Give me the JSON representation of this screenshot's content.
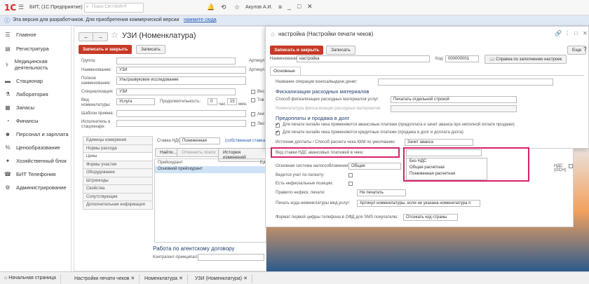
{
  "topbar": {
    "app": "БИТ, (1С:Предприятие)",
    "search_placeholder": "Поиск Ctrl+Shift+F",
    "user": "Акулов А.И."
  },
  "infobar": {
    "text": "Эта версия для разработчиков. Для приобретения коммерческой версии",
    "link": "нажмите сюда"
  },
  "sidebar": {
    "items": [
      {
        "label": "Главное",
        "icon": "menu-icon"
      },
      {
        "label": "Регистратура",
        "icon": "id-card-icon"
      },
      {
        "label": "Медицинская деятельность",
        "icon": "doctor-icon"
      },
      {
        "label": "Стационар",
        "icon": "bed-icon"
      },
      {
        "label": "Лаборатория",
        "icon": "flask-icon"
      },
      {
        "label": "Запасы",
        "icon": "box-icon"
      },
      {
        "label": "Финансы",
        "icon": "finance-icon"
      },
      {
        "label": "Персонал и зарплата",
        "icon": "person-icon"
      },
      {
        "label": "Ценообразование",
        "icon": "percent-icon"
      },
      {
        "label": "Хозяйственный блок",
        "icon": "wrench-icon"
      },
      {
        "label": "БИТ Телефония",
        "icon": "phone-icon"
      },
      {
        "label": "Администрирование",
        "icon": "gear-icon"
      }
    ]
  },
  "win1": {
    "title": "УЗИ (Номенклатура)",
    "save_close": "Записать и закрыть",
    "save": "Записать",
    "fields": {
      "group_label": "Группа:",
      "name_label": "Наименование:",
      "name_value": "УЗИ",
      "full_label": "Полное наименование:",
      "full_value": "Ультразвуковое исследование",
      "spec_label": "Специализация:",
      "spec_value": "УЗИ",
      "vid_label": "Вид номенклатуры:",
      "vid_value": "Услуга",
      "dur_label": "Продолжительность:",
      "dur_h": "0",
      "dur_h_unit": "час.",
      "dur_m": "15",
      "dur_m_unit": "мин.",
      "tpl_label": "Шаблон приема:",
      "exec_label": "Исполнитель в стационаре:",
      "art_label": "Артикул",
      "sklad_label": "Склад",
      "ves_label": "Вес",
      "tov_label": "Тов",
      "ank_label": "Анк",
      "list_label": "Лист"
    },
    "tabs": [
      "Единицы измерения",
      "Нормы расхода",
      "Цены",
      "Формы участия",
      "Оборудование",
      "Штрихкоды",
      "Свойства",
      "Сопутствующие",
      "Дополнительная информация"
    ],
    "vat_label": "Ставка НДС:",
    "vat_value": "Пониженная",
    "vat_link": "(собственная ставка",
    "find_btn": "Найти...",
    "cancel_search": "Отменить поиск",
    "history_btn": "История изменений",
    "pricelist_col": "Прейскурант",
    "ed_col": "Ед.",
    "pricelist_row": "Основной прейскурант",
    "agent_title": "Работа по агентскому договору",
    "principal_label": "Контрагент-принципал:"
  },
  "win2": {
    "title": "настройка (Настройки печати чеков)",
    "save_close": "Записать и закрыть",
    "save": "Записать",
    "name_label": "Наименование:",
    "name_value": "настройка",
    "code_label": "Код:",
    "code_value": "000000001",
    "help_btn": "Справка по заполнению настроек",
    "more": "Еще",
    "tab": "Основные",
    "op_label": "Название операции взноса/выдачи денег:",
    "sec_fisc": "Фискализация расходных материалов",
    "fisc_method_label": "Способ фискализации расходных материалов услуг:",
    "fisc_method_value": "Печатать отдельной строкой",
    "fisc_nom_label": "Номенклатура фискализации расходных материалов:",
    "sec_prepay": "Предоплаты и продажа в долг",
    "cb1": "Для печати онлайн чека применяются авансовые платежи (предоплата и зачет аванса при неполной оплате продажи)",
    "cb2": "Для печати онлайн чека применяются кредитные платежи (продажа в долг и доплата долга)",
    "source_label": "Источник доплаты / Способ расчета чека ККМ по умолчанию:",
    "source_value": "Зачет аванса",
    "vat_adv_label": "Вид ставки НДС авансовых платежей в чеке:",
    "vat_opts": [
      "Без НДС",
      "Общая расчетная",
      "Пониженная расчетная"
    ],
    "tax_label": "Основная система налогообложения:",
    "tax_value": "Общая",
    "nds_osn": "НДС (ОСН)",
    "patent_label": "Ведется учет по патенту:",
    "nonfisc_label": "Есть нефискальные позиции:",
    "nonfisc_rule_label": "Правило нефиск. печати:",
    "nonfisc_rule_value": "Не печатать",
    "print_code_label": "Печать кода номенклатуры мед.услуг:",
    "print_code_value": "Артикул номенклатуры, если не указана номенклатура п",
    "phone_label": "Формат первой цифры телефона в ОФД для SMS покупателю:",
    "phone_value": "Отсекать код страны"
  },
  "taskbar": {
    "items": [
      "Начальная страница",
      "Настройки печати чеков",
      "Номенклатура",
      "УЗИ (Номенклатура)"
    ]
  }
}
